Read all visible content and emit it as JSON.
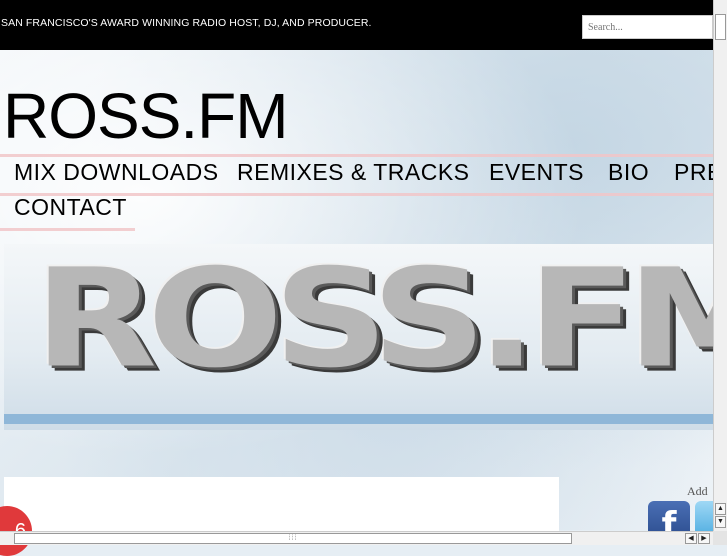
{
  "header": {
    "tagline": "SAN FRANCISCO'S AWARD WINNING RADIO HOST, DJ, AND PRODUCER.",
    "search_placeholder": "Search..."
  },
  "site": {
    "title": "ROSS.FM"
  },
  "nav": {
    "items": [
      {
        "label": "MIX DOWNLOADS"
      },
      {
        "label": "REMIXES & TRACKS"
      },
      {
        "label": "EVENTS"
      },
      {
        "label": "BIO"
      },
      {
        "label": "PRE"
      },
      {
        "label": "CONTACT"
      }
    ]
  },
  "banner": {
    "logo_text": "ROSS.FM"
  },
  "sidebar": {
    "add_label": "Add",
    "social_icons": [
      "facebook-icon",
      "twitter-icon"
    ],
    "facebook_glyph": "f"
  },
  "badge": {
    "text": "6"
  },
  "colors": {
    "topbar": "#000000",
    "facebook": "#3b5998",
    "twitter": "#55acee",
    "badge": "#e0393b"
  }
}
